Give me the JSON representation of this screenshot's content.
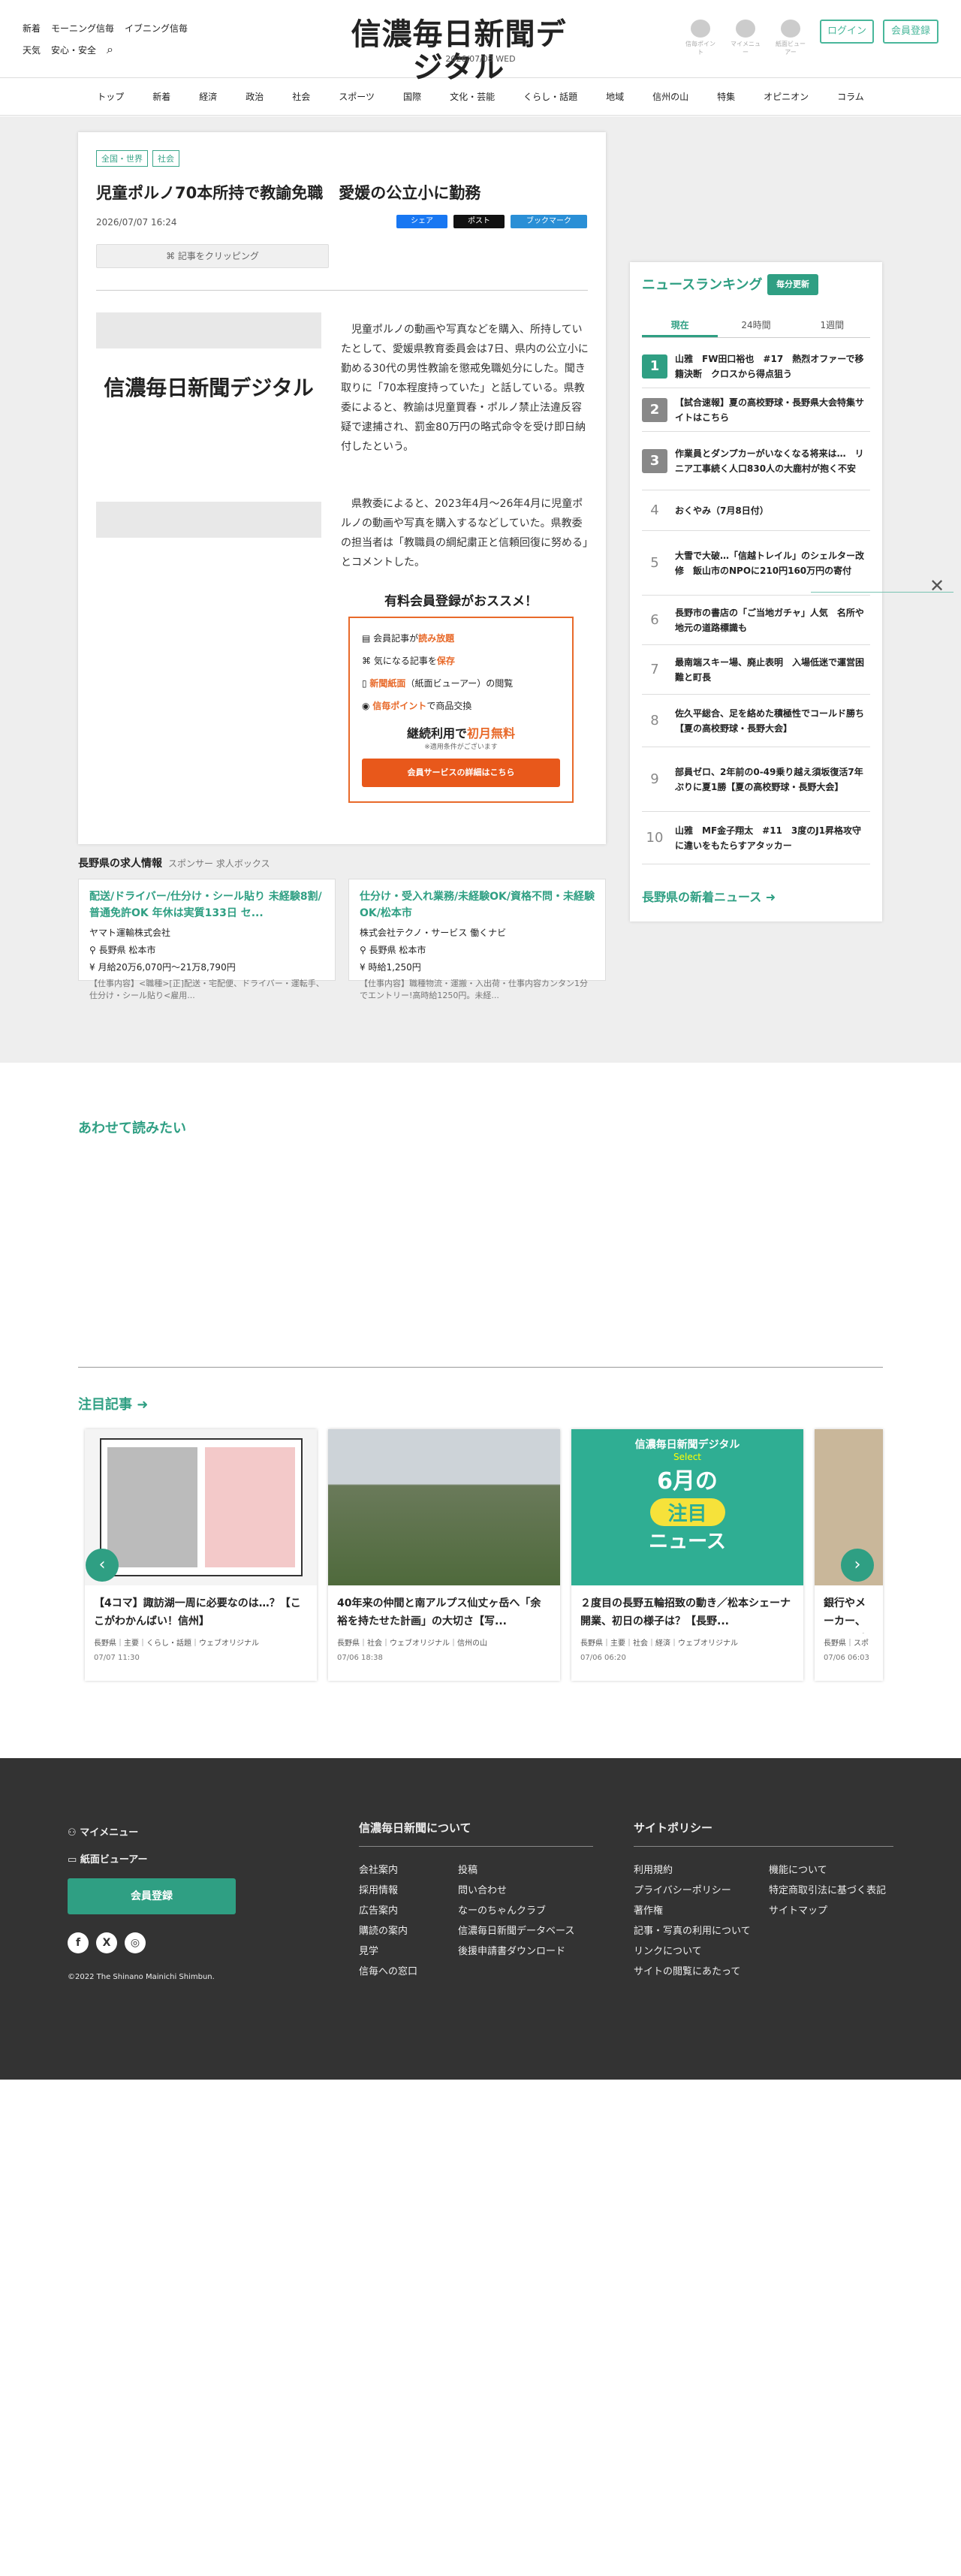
{
  "header": {
    "links1": [
      "新着",
      "モーニング信毎",
      "イブニング信毎"
    ],
    "links2": [
      "天気",
      "安心・安全"
    ],
    "logo": "信濃毎日新聞デジタル",
    "date": "2026/07/08 WED",
    "icons": [
      "信毎ポイント",
      "マイメニュー",
      "紙面ビューアー"
    ],
    "login": "ログイン",
    "register": "会員登録"
  },
  "nav": [
    "トップ",
    "新着",
    "経済",
    "政治",
    "社会",
    "スポーツ",
    "国際",
    "文化・芸能",
    "くらし・話題",
    "地域",
    "信州の山",
    "特集",
    "オピニオン",
    "コラム"
  ],
  "article": {
    "tags": [
      "全国・世界",
      "社会"
    ],
    "title": "児童ポルノ70本所持で教諭免職　愛媛の公立小に勤務",
    "date": "2026/07/07 16:24",
    "share": [
      "シェア",
      "ポスト",
      "ブックマーク"
    ],
    "clip": "記事をクリッピング",
    "logo": "信濃毎日新聞デジタル",
    "p1": "児童ポルノの動画や写真などを購入、所持していたとして、愛媛県教育委員会は7日、県内の公立小に勤める30代の男性教諭を懲戒免職処分にした。聞き取りに「70本程度持っていた」と話している。県教委によると、教諭は児童買春・ポルノ禁止法違反容疑で逮捕され、罰金80万円の略式命令を受け即日納付したという。",
    "p2": "県教委によると、2023年4月〜26年4月に児童ポルノの動画や写真を購入するなどしていた。県教委の担当者は「教職員の綱紀粛正と信頼回復に努める」とコメントした。"
  },
  "promo": {
    "title": "有料会員登録がおススメ！",
    "items": [
      [
        "会員記事が",
        "読み放題",
        ""
      ],
      [
        "気になる記事を",
        "保存",
        ""
      ],
      [
        "新聞紙面",
        "（紙面ビューアー）の閲覧",
        ""
      ],
      [
        "信毎ポイント",
        "で商品交換",
        ""
      ]
    ],
    "cont1": "継続利用で",
    "cont2": "初月無料",
    "note": "※適用条件がございます",
    "btn": "会員サービスの詳細はこちら"
  },
  "jobs": {
    "title": "長野県の求人情報",
    "sponsor": "スポンサー 求人ボックス",
    "items": [
      {
        "title": "配送/ドライバー/仕分け・シール貼り 未経験8割/普通免許OK 年休は実質133日 セ...",
        "company": "ヤマト運輸株式会社",
        "loc": "長野県 松本市",
        "pay": "月給20万6,070円〜21万8,790円",
        "desc": "【仕事内容】<職種>[正]配送・宅配便、ドライバー・運転手、仕分け・シール貼り<雇用..."
      },
      {
        "title": "仕分け・受入れ業務/未経験OK/資格不問・未経験OK/松本市",
        "company": "株式会社テクノ・サービス 働くナビ",
        "loc": "長野県 松本市",
        "pay": "時給1,250円",
        "desc": "【仕事内容】職種物流・運搬・入出荷・仕事内容カンタン1分でエントリー!高時給1250円。未経..."
      }
    ]
  },
  "ranking": {
    "title": "ニュースランキング",
    "badge": "毎分更新",
    "tabs": [
      "現在",
      "24時間",
      "1週間"
    ],
    "items": [
      "山雅　FW田口裕也　#17　熱烈オファーで移籍決断　クロスから得点狙う",
      "【試合速報】夏の高校野球・長野県大会特集サイトはこちら",
      "作業員とダンプカーがいなくなる将来は…　リニア工事続く人口830人の大鹿村が抱く不安",
      "おくやみ（7月8日付）",
      "大雪で大破…「信越トレイル」のシェルター改修　飯山市のNPOに210円160万円の寄付",
      "長野市の書店の「ご当地ガチャ」人気　名所や地元の道路標識も",
      "最南端スキー場、廃止表明　入場低迷で運営困難と町長",
      "佐久平総合、足を絡めた積極性でコールド勝ち【夏の高校野球・長野大会】",
      "部員ゼロ、2年前の0-49乗り越え須坂復活7年ぶりに夏1勝【夏の高校野球・長野大会】",
      "山雅　MF金子翔太　#11　3度のJ1昇格攻守に違いをもたらすアタッカー"
    ],
    "more": "長野県の新着ニュース"
  },
  "related": {
    "title": "あわせて読みたい"
  },
  "featured": {
    "title": "注目記事",
    "cards": [
      {
        "title": "【4コマ】諏訪湖一周に必要なのは…？【ここがわかんばい！信州】",
        "cats": "長野県｜主要｜くらし・話題｜ウェブオリジナル",
        "ts": "07/07 11:30"
      },
      {
        "title": "40年来の仲間と南アルプス仙丈ヶ岳へ「余裕を持たせた計画」の大切さ【写...",
        "cats": "長野県｜社会｜ウェブオリジナル｜信州の山",
        "ts": "07/06 18:38"
      },
      {
        "title": "２度目の長野五輪招致の動き／松本シェーナ開業、初日の様子は？【長野...",
        "cats": "長野県｜主要｜社会｜経済｜ウェブオリジナル",
        "ts": "07/06 06:20"
      },
      {
        "title": "銀行やメーカー、ネット系企業… Bリーグ輝...",
        "cats": "長野県｜スポ",
        "ts": "07/06 06:03"
      }
    ],
    "card3": {
      "a": "信濃毎日新聞デジタル",
      "b": "Select",
      "c": "6月の",
      "d": "注目",
      "e": "ニュース"
    }
  },
  "footer": {
    "mymenu": "マイメニュー",
    "viewer": "紙面ビューアー",
    "register": "会員登録",
    "copy": "©2022 The Shinano Mainichi Shimbun.",
    "aboutTitle": "信濃毎日新聞について",
    "about1": [
      "会社案内",
      "採用情報",
      "広告案内",
      "購読の案内",
      "見学",
      "信毎への窓口"
    ],
    "about2": [
      "投稿",
      "問い合わせ",
      "なーのちゃんクラブ",
      "信濃毎日新聞データベース",
      "後援申請書ダウンロード"
    ],
    "policyTitle": "サイトポリシー",
    "pol1": [
      "利用規約",
      "プライバシーポリシー",
      "著作権",
      "記事・写真の利用について",
      "リンクについて",
      "サイトの閲覧にあたって"
    ],
    "pol2": [
      "機能について",
      "特定商取引法に基づく表記",
      "サイトマップ"
    ]
  },
  "colors": {
    "accent": "#2f9f83",
    "orange": "#e8581b",
    "footer": "#333333"
  }
}
